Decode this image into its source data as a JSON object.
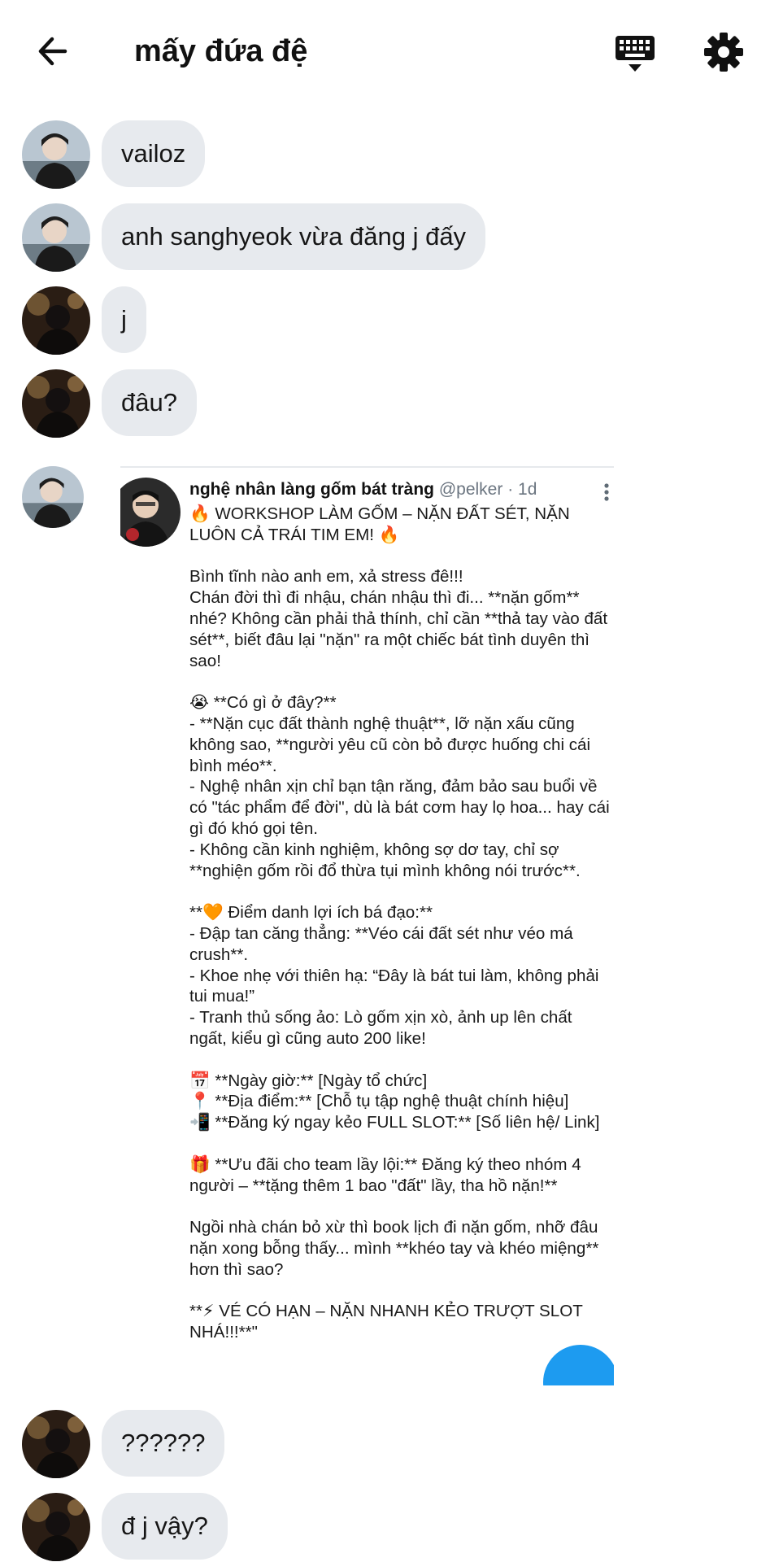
{
  "header": {
    "title": "mấy đứa đệ",
    "back_icon": "arrow-left-icon",
    "keyboard_icon": "keyboard-icon",
    "settings_icon": "gear-icon"
  },
  "messages": [
    {
      "text": "vailoz",
      "sender": "friend-a"
    },
    {
      "text": "anh sanghyeok vừa đăng j đấy",
      "sender": "friend-a"
    },
    {
      "text": "j",
      "sender": "friend-b"
    },
    {
      "text": "đâu?",
      "sender": "friend-b"
    },
    {
      "text": "??????",
      "sender": "friend-b"
    },
    {
      "text": "đ j vậy?",
      "sender": "friend-b"
    }
  ],
  "tweet": {
    "name": "nghệ nhân làng gốm bát tràng",
    "handle": "@pelker · 1d",
    "body": "🔥 WORKSHOP LÀM GỐM – NẶN ĐẤT SÉT, NẶN LUÔN CẢ TRÁI TIM EM! 🔥\n\nBình tĩnh nào anh em, xả stress đê!!!\nChán đời thì đi nhậu, chán nhậu thì đi... **nặn gốm** nhé? Không cần phải thả thính, chỉ cần **thả tay vào đất sét**, biết đâu lại \"nặn\" ra một chiếc bát tình duyên thì sao!\n\n😭 **Có gì ở đây?**\n- **Nặn cục đất thành nghệ thuật**, lỡ nặn xấu cũng không sao, **người yêu cũ còn bỏ được huống chi cái bình méo**.\n- Nghệ nhân xịn chỉ bạn tận răng, đảm bảo sau buổi về có \"tác phẩm để đời\", dù là bát cơm hay lọ hoa... hay cái gì đó khó gọi tên.\n- Không cần kinh nghiệm, không sợ dơ tay, chỉ sợ **nghiện gốm rồi đổ thừa tụi mình không nói trước**.\n\n**🧡 Điểm danh lợi ích bá đạo:**\n- Đập tan căng thẳng: **Véo cái đất sét như véo má crush**.\n- Khoe nhẹ với thiên hạ: “Đây là bát tui làm, không phải tui mua!”\n- Tranh thủ sống ảo: Lò gốm xịn xò, ảnh up lên chất ngất, kiểu gì cũng auto 200 like!\n\n📅 **Ngày giờ:** [Ngày tổ chức]\n📍 **Địa điểm:** [Chỗ tụ tập nghệ thuật chính hiệu]\n📲 **Đăng ký ngay kẻo FULL SLOT:** [Số liên hệ/ Link]\n\n🎁 **Ưu đãi cho team lầy lội:** Đăng ký theo nhóm 4 người – **tặng thêm 1 bao \"đất\" lầy, tha hồ nặn!**\n\nNgồi nhà chán bỏ xừ thì book lịch đi nặn gốm, nhỡ đâu nặn xong bỗng thấy... mình **khéo tay và khéo miệng** hơn thì sao?\n\n**⚡ VÉ CÓ HẠN – NẶN NHANH KẺO TRƯỢT SLOT NHÁ!!!**\""
  },
  "colors": {
    "bubble": "#e7eaee",
    "accent": "#1d9bf0",
    "text": "#111111"
  }
}
